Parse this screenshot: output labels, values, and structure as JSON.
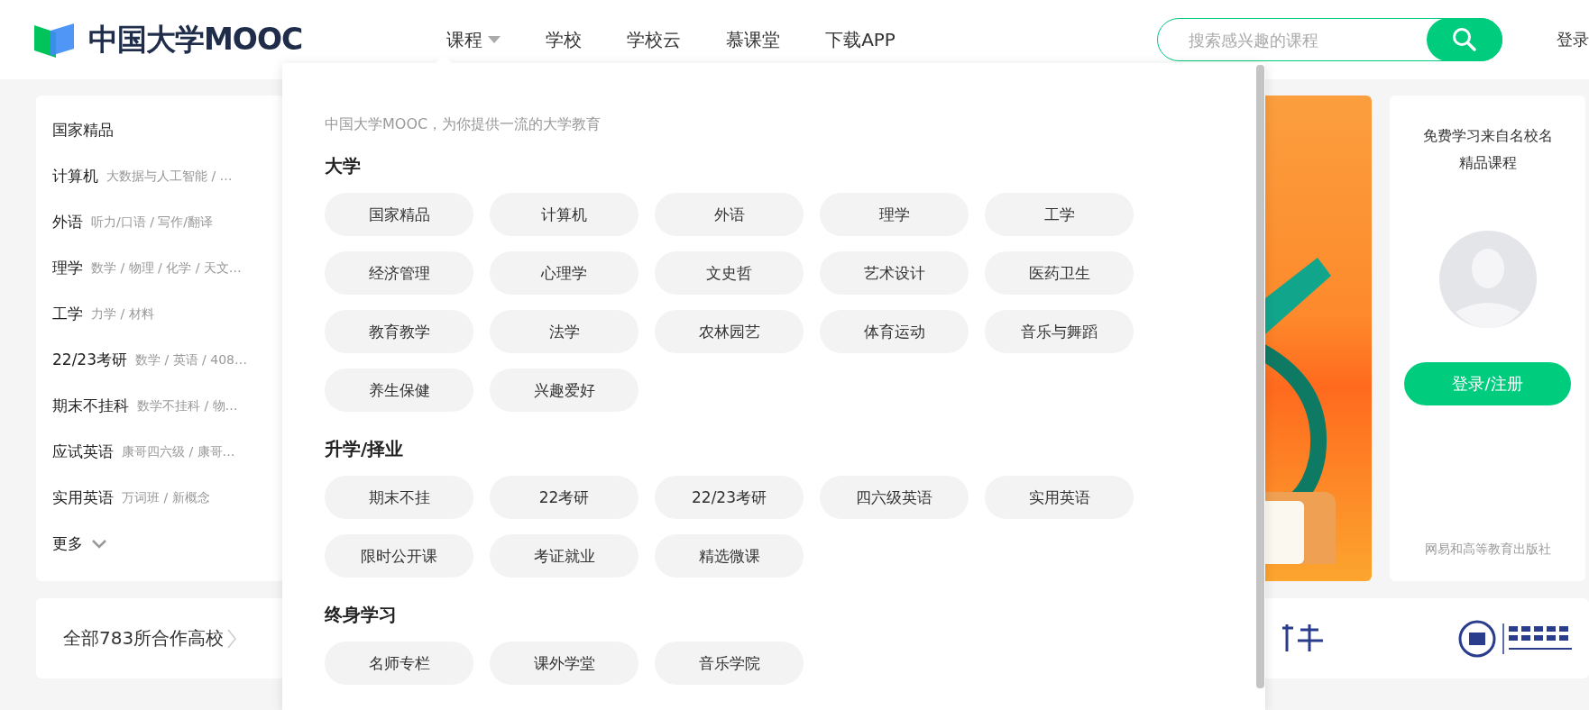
{
  "header": {
    "logo": "中国大学MOOC",
    "nav": [
      {
        "label": "课程",
        "has_menu": true
      },
      {
        "label": "学校",
        "has_menu": false
      },
      {
        "label": "学校云",
        "has_menu": false
      },
      {
        "label": "慕课堂",
        "has_menu": false
      },
      {
        "label": "下载APP",
        "has_menu": false
      }
    ],
    "search": {
      "placeholder": "搜索感兴趣的课程"
    },
    "login": "登录"
  },
  "sidebar": {
    "items": [
      {
        "title": "国家精品"
      },
      {
        "title": "计算机",
        "subtitle": "大数据与人工智能 / …"
      },
      {
        "title": "外语",
        "subtitle": "听力/口语 / 写作/翻译"
      },
      {
        "title": "理学",
        "subtitle": "数学 / 物理 / 化学 / 天文…"
      },
      {
        "title": "工学",
        "subtitle": "力学 / 材料"
      },
      {
        "title": "22/23考研",
        "subtitle": "数学 / 英语 / 408…"
      },
      {
        "title": "期末不挂科",
        "subtitle": "数学不挂科 / 物…"
      },
      {
        "title": "应试英语",
        "subtitle": "康哥四六级 / 康哥…"
      },
      {
        "title": "实用英语",
        "subtitle": "万词班 / 新概念"
      }
    ],
    "more": "更多"
  },
  "partners": {
    "label": "全部783所合作高校"
  },
  "user_card": {
    "lines": [
      "免费学习来自名校名",
      "精品课程"
    ],
    "button": "登录/注册",
    "footer": "网易和高等教育出版社"
  },
  "dropdown": {
    "intro": "中国大学MOOC，为你提供一流的大学教育",
    "sections": [
      {
        "title": "大学",
        "chips": [
          "国家精品",
          "计算机",
          "外语",
          "理学",
          "工学",
          "经济管理",
          "心理学",
          "文史哲",
          "艺术设计",
          "医药卫生",
          "教育教学",
          "法学",
          "农林园艺",
          "体育运动",
          "音乐与舞蹈",
          "养生保健",
          "兴趣爱好"
        ]
      },
      {
        "title": "升学/择业",
        "chips": [
          "期末不挂",
          "22考研",
          "22/23考研",
          "四六级英语",
          "实用英语",
          "限时公开课",
          "考证就业",
          "精选微课"
        ]
      },
      {
        "title": "终身学习",
        "chips": [
          "名师专栏",
          "课外学堂",
          "音乐学院"
        ]
      }
    ]
  }
}
